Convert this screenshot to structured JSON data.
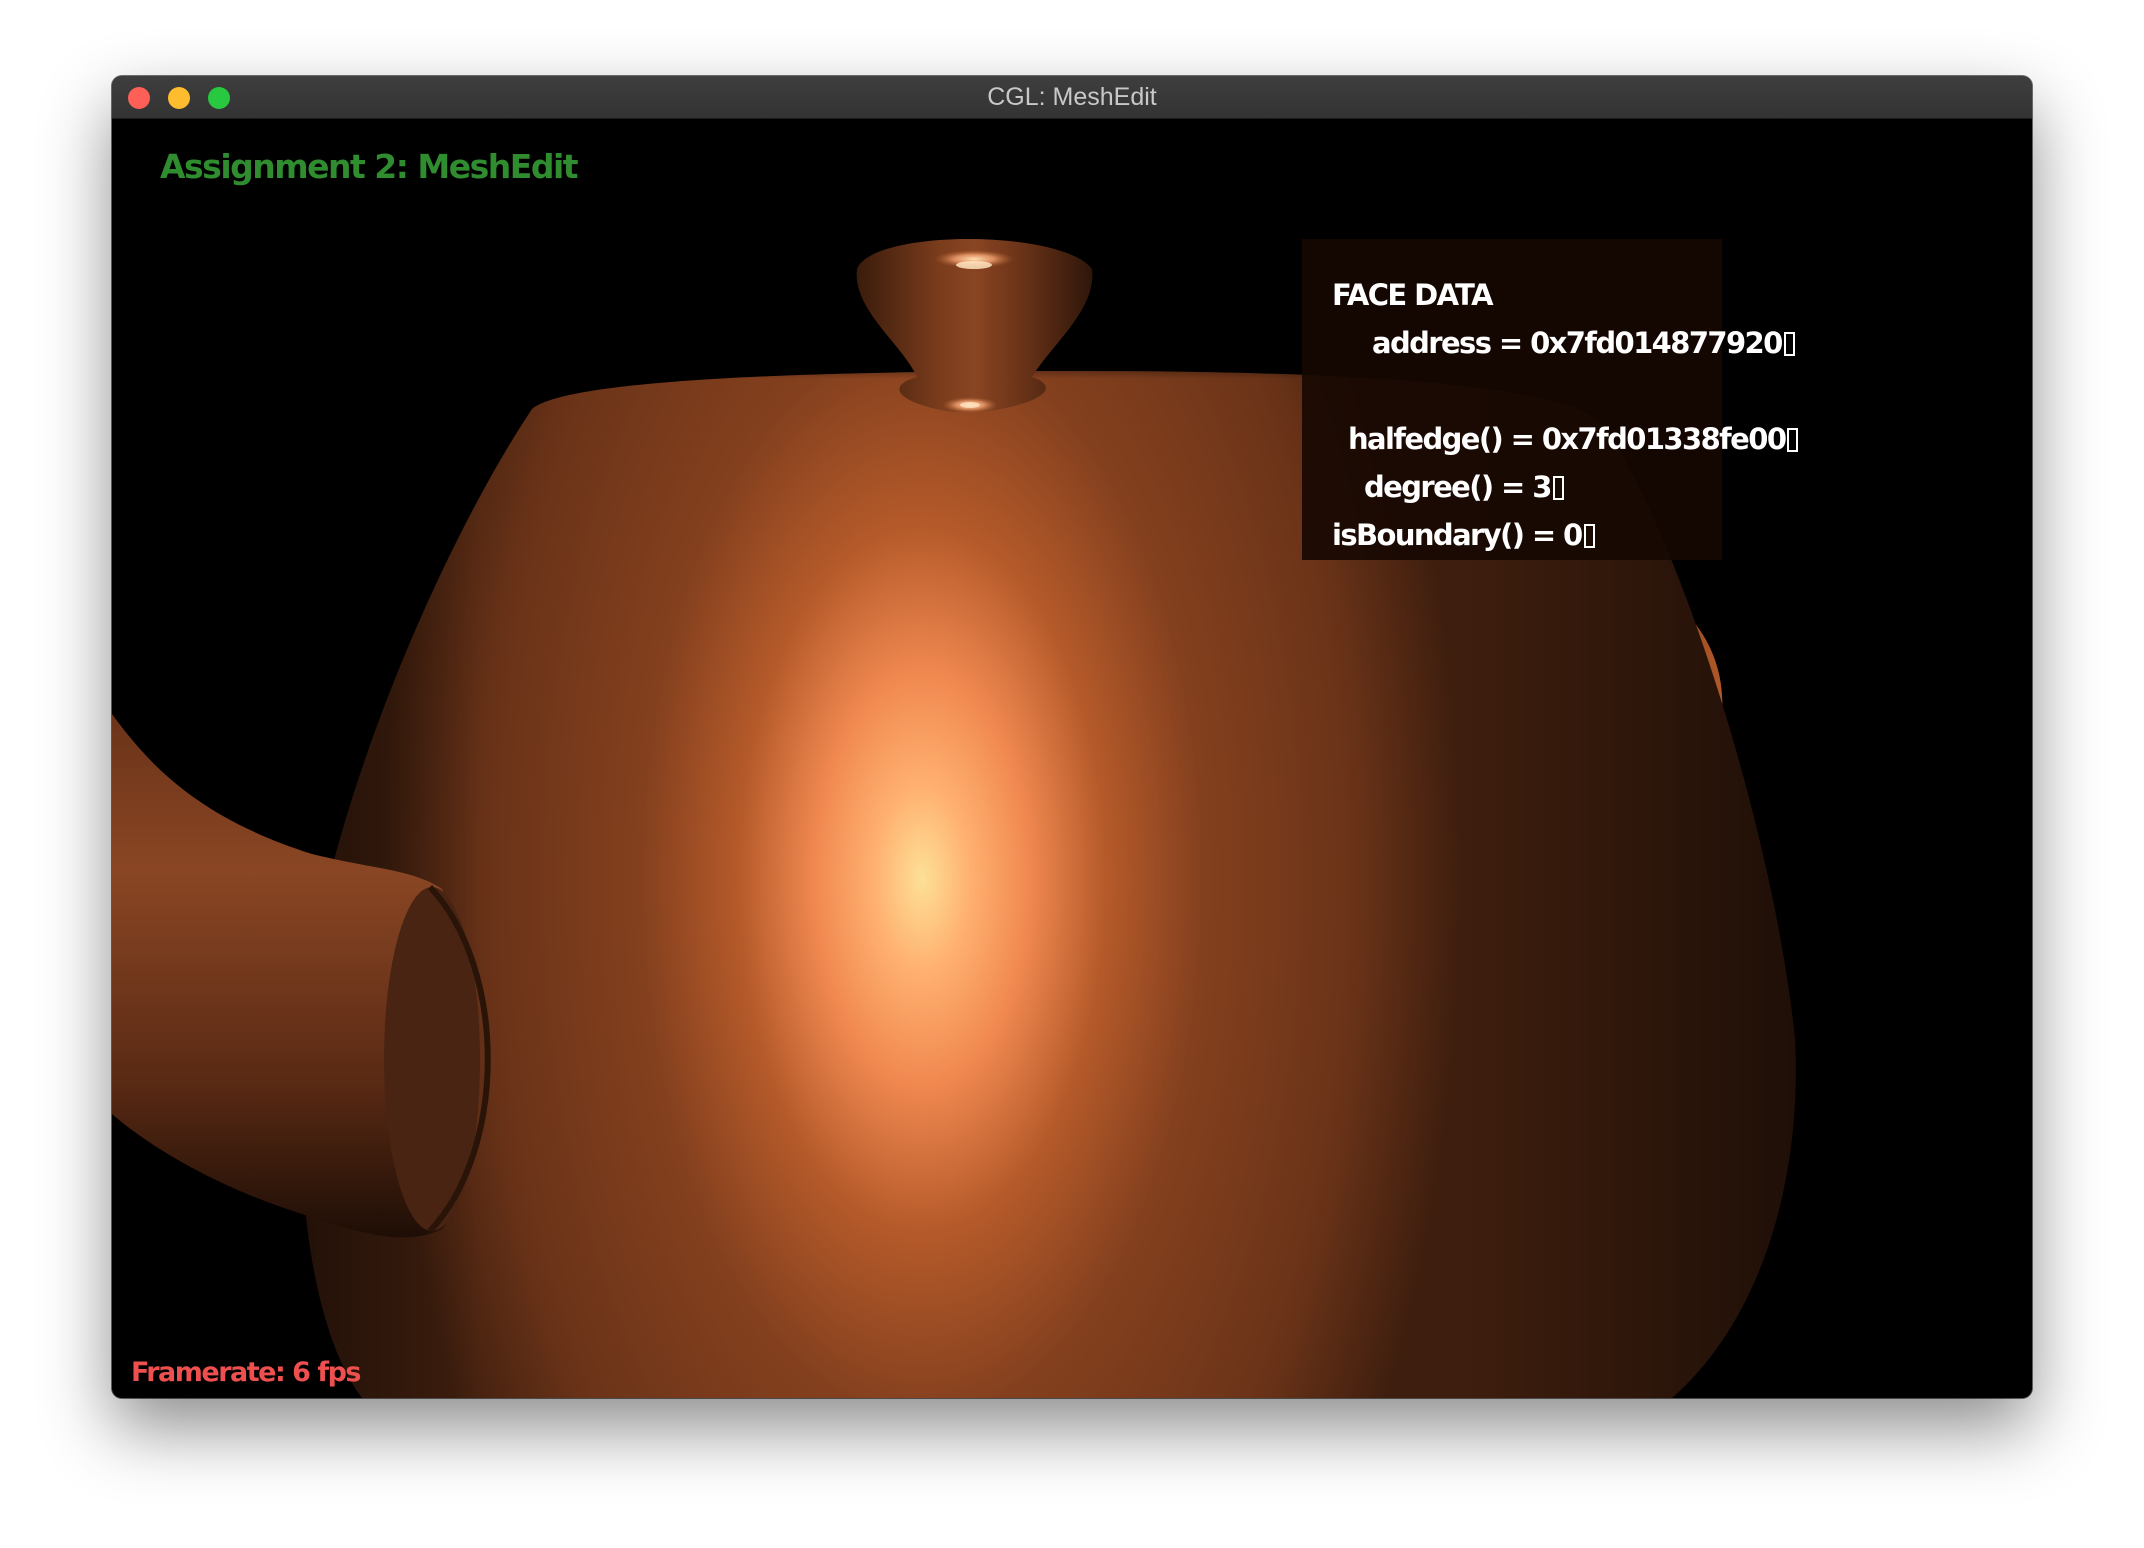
{
  "window": {
    "title": "CGL: MeshEdit",
    "traffic_lights": {
      "close_color": "#fe5f57",
      "minimize_color": "#febc2e",
      "maximize_color": "#28c840"
    }
  },
  "viewport": {
    "background": "#000000",
    "app_title": "Assignment 2: MeshEdit",
    "app_title_color": "#2f8c2f",
    "framerate_text": "Framerate: 6 fps",
    "framerate_color": "#ee5050",
    "model": "teapot-icon"
  },
  "face_data": {
    "heading": "FACE DATA",
    "address": "address = 0x7fd014877920",
    "halfedge": "halfedge() = 0x7fd01338fe00",
    "degree": "degree() = 3",
    "is_boundary": "isBoundary() = 0"
  }
}
